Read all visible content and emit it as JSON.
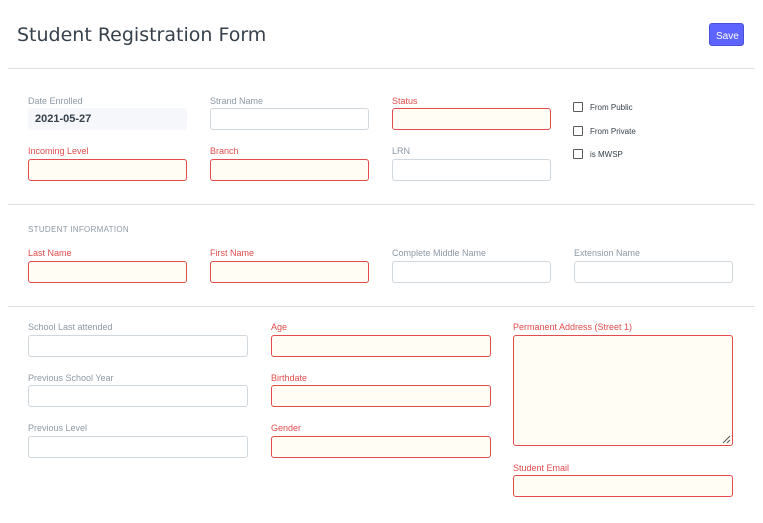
{
  "header": {
    "title": "Student Registration Form",
    "save_label": "Save"
  },
  "enrollment": {
    "date_enrolled_label": "Date Enrolled",
    "date_enrolled_value": "2021-05-27",
    "strand_name_label": "Strand Name",
    "status_label": "Status",
    "incoming_level_label": "Incoming Level",
    "branch_label": "Branch",
    "lrn_label": "LRN",
    "checkboxes": [
      {
        "label": "From Public",
        "checked": false
      },
      {
        "label": "From Private",
        "checked": false
      },
      {
        "label": "is MWSP",
        "checked": false
      }
    ]
  },
  "student_info": {
    "section_title": "STUDENT INFORMATION",
    "last_name_label": "Last Name",
    "first_name_label": "First Name",
    "middle_name_label": "Complete Middle Name",
    "extension_name_label": "Extension Name"
  },
  "school": {
    "school_last_attended_label": "School Last attended",
    "previous_school_year_label": "Previous School Year",
    "previous_level_label": "Previous Level",
    "age_label": "Age",
    "birthdate_label": "Birthdate",
    "gender_label": "Gender",
    "permanent_address_label": "Permanent Address (Street 1)",
    "student_email_label": "Student Email"
  },
  "colors": {
    "required": "#e24c4c",
    "required_bg": "#fffdf4",
    "primary": "#5e64ff",
    "label": "#8d99a6"
  }
}
